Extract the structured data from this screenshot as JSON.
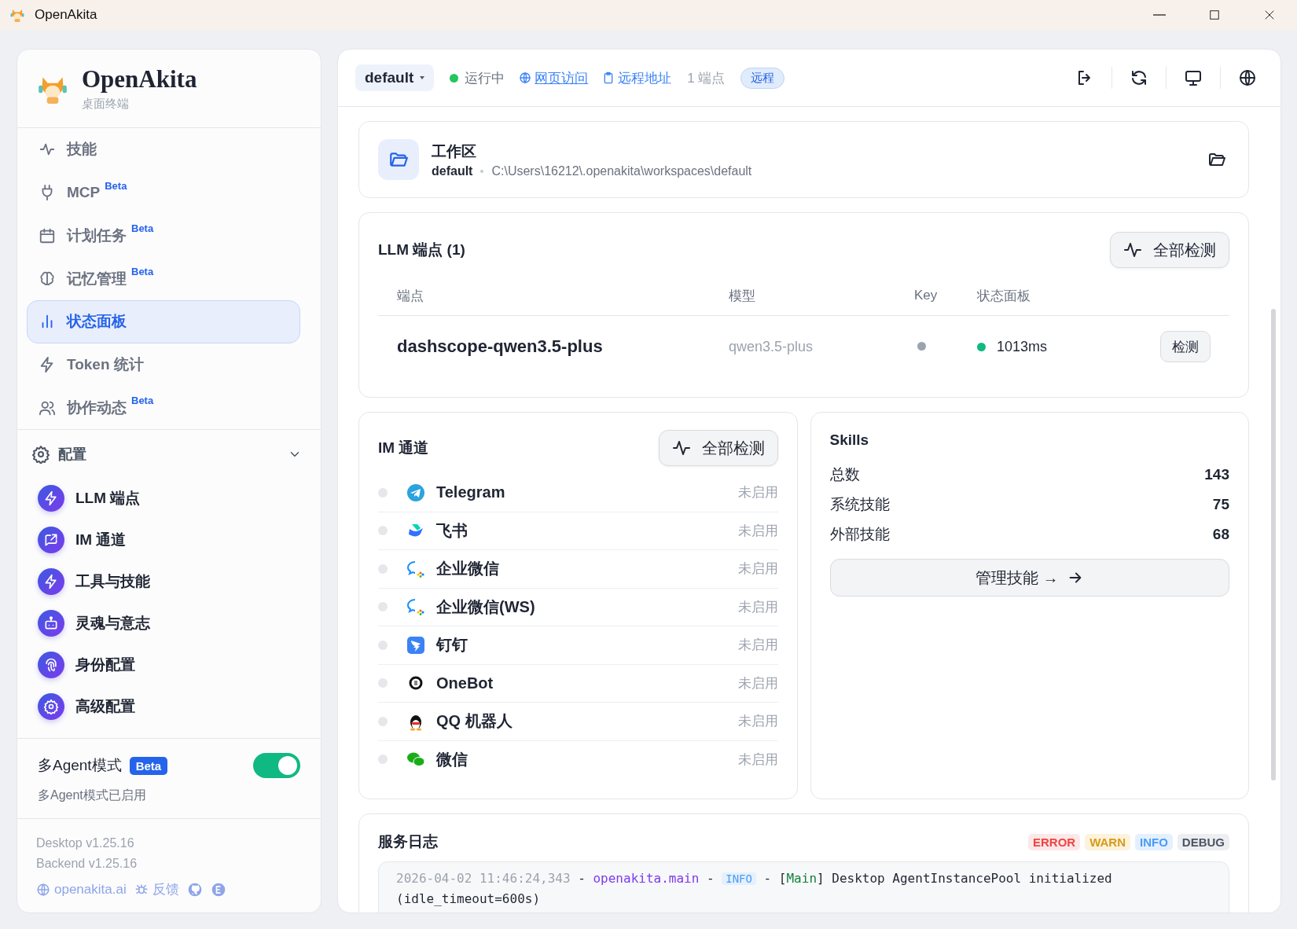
{
  "window": {
    "title": "OpenAkita"
  },
  "sidebar": {
    "brand": {
      "name": "OpenAkita",
      "subtitle": "桌面终端"
    },
    "nav": [
      {
        "label": "技能",
        "selected": false
      },
      {
        "label": "MCP",
        "badge": "Beta",
        "selected": false
      },
      {
        "label": "计划任务",
        "badge": "Beta",
        "selected": false
      },
      {
        "label": "记忆管理",
        "badge": "Beta",
        "selected": false
      },
      {
        "label": "状态面板",
        "selected": true
      },
      {
        "label": "Token 统计",
        "selected": false
      },
      {
        "label": "协作动态",
        "badge": "Beta",
        "selected": false
      }
    ],
    "config": {
      "label": "配置",
      "expanded": true,
      "items": [
        {
          "label": "LLM 端点"
        },
        {
          "label": "IM 通道"
        },
        {
          "label": "工具与技能"
        },
        {
          "label": "灵魂与意志"
        },
        {
          "label": "身份配置"
        },
        {
          "label": "高级配置"
        }
      ]
    },
    "multi_agent": {
      "label": "多Agent模式",
      "badge": "Beta",
      "on": true,
      "note": "多Agent模式已启用"
    },
    "versions": [
      "Desktop v1.25.16",
      "Backend v1.25.16"
    ],
    "links": [
      {
        "kind": "web",
        "label": "openakita.ai"
      },
      {
        "kind": "bug",
        "label": "反馈"
      },
      {
        "kind": "github"
      },
      {
        "kind": "e"
      }
    ]
  },
  "header": {
    "workspace": "default",
    "status": {
      "label": "运行中",
      "running": true
    },
    "links": [
      {
        "kind": "globe",
        "label": "网页访问",
        "underline": true
      },
      {
        "kind": "clipboard",
        "label": "远程地址",
        "underline": false
      }
    ],
    "endpoints": "1 端点",
    "tag": "远程",
    "actions": [
      {
        "kind": "logout"
      },
      {
        "kind": "refresh"
      },
      {
        "kind": "monitor"
      },
      {
        "kind": "globe"
      }
    ]
  },
  "workspace": {
    "title": "工作区",
    "name": "default",
    "path": "C:\\Users\\16212\\.openakita\\workspaces\\default"
  },
  "llm": {
    "title": "LLM 端点 (1)",
    "check_all": "全部检测",
    "columns": [
      "端点",
      "模型",
      "Key",
      "状态面板"
    ],
    "rows": [
      {
        "endpoint": "dashscope-qwen3.5-plus",
        "model": "qwen3.5-plus",
        "key_ok": false,
        "healthy": true,
        "latency": "1013ms",
        "action": "检测"
      }
    ]
  },
  "im": {
    "title": "IM 通道",
    "check_all": "全部检测",
    "channels": [
      {
        "name": "Telegram",
        "kind": "telegram",
        "enabled": false,
        "status": "未启用"
      },
      {
        "name": "飞书",
        "kind": "feishu",
        "enabled": false,
        "status": "未启用"
      },
      {
        "name": "企业微信",
        "kind": "wecom",
        "enabled": false,
        "status": "未启用"
      },
      {
        "name": "企业微信(WS)",
        "kind": "wecom",
        "enabled": false,
        "status": "未启用"
      },
      {
        "name": "钉钉",
        "kind": "dingtalk",
        "enabled": false,
        "status": "未启用"
      },
      {
        "name": "OneBot",
        "kind": "onebot",
        "enabled": false,
        "status": "未启用"
      },
      {
        "name": "QQ 机器人",
        "kind": "qq",
        "enabled": false,
        "status": "未启用"
      },
      {
        "name": "微信",
        "kind": "wechat",
        "enabled": false,
        "status": "未启用"
      }
    ]
  },
  "skills": {
    "title": "Skills",
    "stats": [
      {
        "label": "总数",
        "value": "143"
      },
      {
        "label": "系统技能",
        "value": "75"
      },
      {
        "label": "外部技能",
        "value": "68"
      }
    ],
    "manage": "管理技能 →"
  },
  "logs": {
    "title": "服务日志",
    "levels": [
      {
        "label": "ERROR",
        "kind": "error"
      },
      {
        "label": "WARN",
        "kind": "warn"
      },
      {
        "label": "INFO",
        "kind": "info"
      },
      {
        "label": "DEBUG",
        "kind": "debug"
      }
    ],
    "entries": [
      {
        "parts": [
          {
            "kind": "time",
            "text": "2026-04-02 11:46:24,343"
          },
          {
            "kind": "plain",
            "text": " - "
          },
          {
            "kind": "source",
            "text": "openakita.main"
          },
          {
            "kind": "plain",
            "text": " - "
          },
          {
            "kind": "level",
            "text": "INFO"
          },
          {
            "kind": "plain",
            "text": " - ["
          },
          {
            "kind": "module",
            "text": "Main"
          },
          {
            "kind": "plain",
            "text": "] Desktop AgentInstancePool initialized (idle_timeout=600s)"
          }
        ]
      }
    ]
  }
}
